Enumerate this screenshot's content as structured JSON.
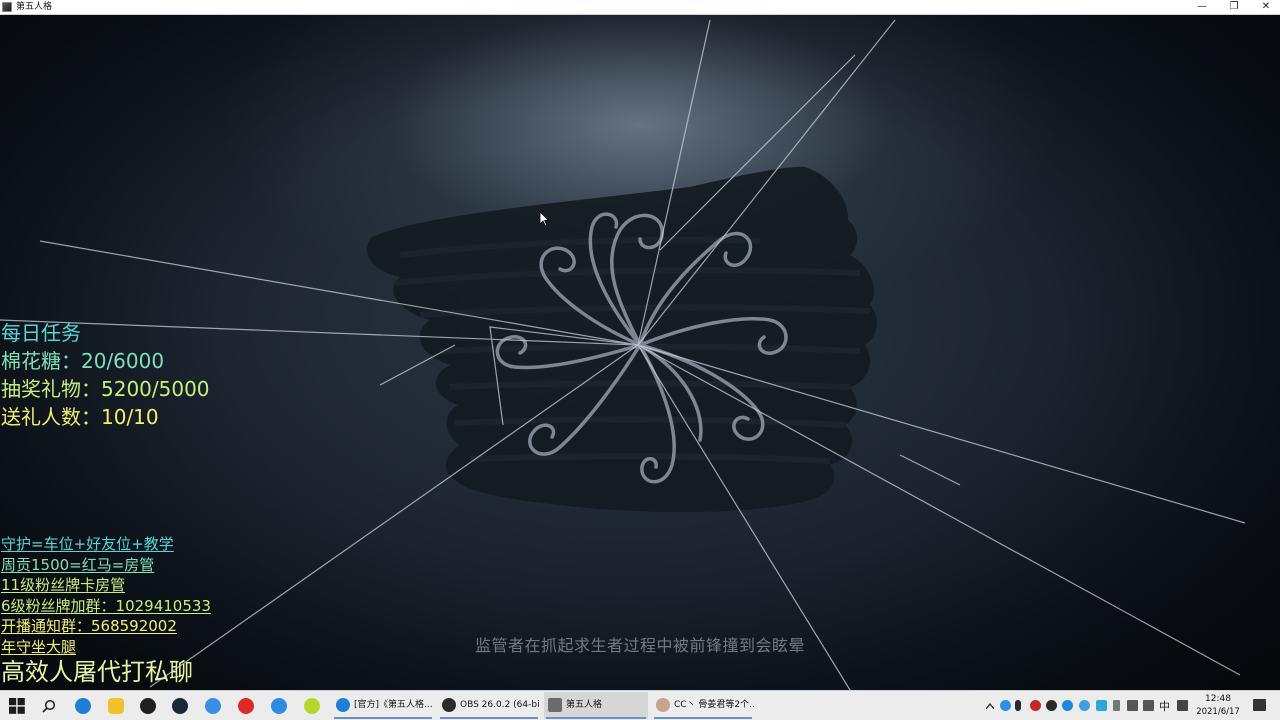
{
  "window": {
    "title": "第五人格",
    "minimize_glyph": "—",
    "maximize_glyph": "❐",
    "close_glyph": "✕"
  },
  "hud": {
    "daily_title": "每日任务",
    "cotton_candy": "棉花糖：20/6000",
    "lottery_gift": "抽奖礼物：5200/5000",
    "gift_senders": "送礼人数：10/10",
    "guard": "守护=车位+好友位+教学",
    "weekly": "周贡1500=红马=房管",
    "fan_badge_11": "11级粉丝牌卡房管",
    "fan_group": "6级粉丝牌加群：1029410533",
    "live_notice_group": "开播通知群：568592002",
    "annual_guard": "年守坐大腿",
    "promo": "高效人屠代打私聊"
  },
  "game": {
    "loading_tip": "监管者在抓起求生者过程中被前锋撞到会眩晕"
  },
  "taskbar": {
    "tasks": [
      {
        "label": "[官方]《第五人格...",
        "icon": "edge-icon"
      },
      {
        "label": "OBS 26.0.2 (64-bi...",
        "icon": "obs-icon"
      },
      {
        "label": "第五人格",
        "icon": "game-icon"
      },
      {
        "label": "CC丶 骨姜君等2个...",
        "icon": "avatar-icon"
      }
    ],
    "ime": "中",
    "time": "12:48",
    "date": "2021/6/17"
  },
  "colors": {
    "hud_cyan": "#55d6d8",
    "hud_lime": "#c6ef7a",
    "hud_yellow": "#f2ef6c",
    "taskbar_bg": "#ececec"
  }
}
